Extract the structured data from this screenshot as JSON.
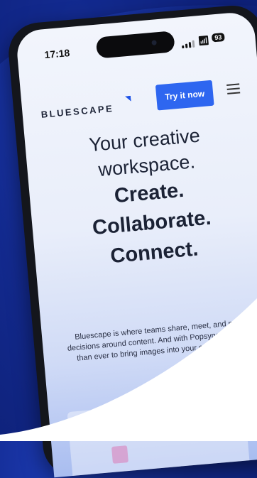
{
  "status_bar": {
    "time": "17:18",
    "battery": "93",
    "wifi_icon": "wifi-icon",
    "signal_icon": "signal-icon"
  },
  "header": {
    "logo_text": "BLUESCAPE",
    "cta_label": "Try it now",
    "menu_icon": "hamburger-menu-icon"
  },
  "hero": {
    "line1": "Your creative",
    "line2": "workspace.",
    "line3": "Create.",
    "line4": "Collaborate.",
    "line5": "Connect."
  },
  "description": "Bluescape is where teams share, meet, and make decisions around content. And with Popsync, it's easier than ever to bring images into your conversations.",
  "colors": {
    "background": "#132a8f",
    "accent": "#2e66f0",
    "text": "#1b2235",
    "wave": "#ffffff"
  }
}
